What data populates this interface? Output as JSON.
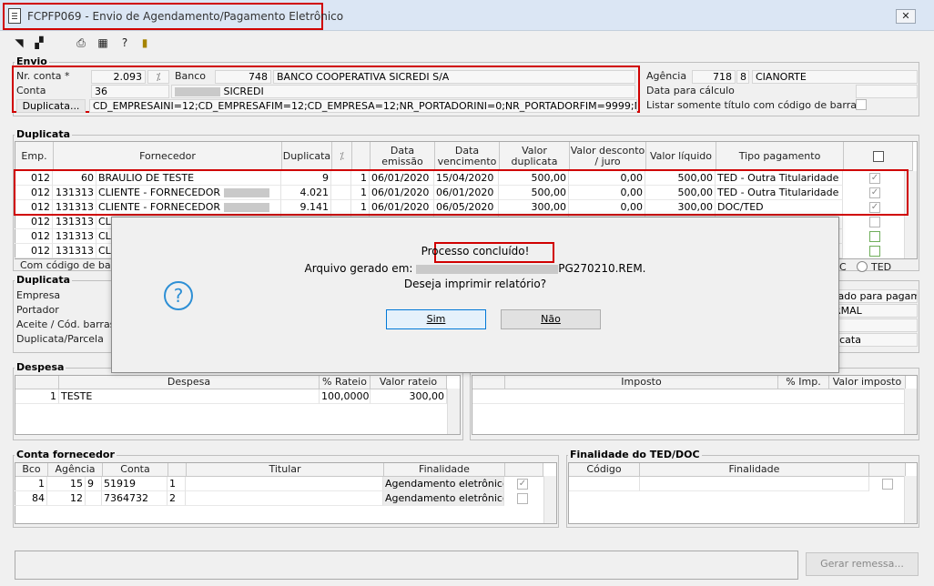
{
  "window": {
    "title": "FCPFP069 - Envio de Agendamento/Pagamento Eletrônico",
    "close_label": "✕"
  },
  "envio": {
    "group_title": "Envio",
    "nr_conta_label": "Nr. conta *",
    "nr_conta_value": "2.093",
    "banco_label": "Banco",
    "banco_code": "748",
    "banco_name": "BANCO COOPERATIVA SICREDI S/A",
    "conta_label": "Conta",
    "conta_value": "36",
    "conta_name": "SICREDI",
    "duplicata_btn": "Duplicata...",
    "duplicata_filter": "CD_EMPRESAINI=12;CD_EMPRESAFIM=12;CD_EMPRESA=12;NR_PORTADORINI=0;NR_PORTADORFIM=9999;NR_PORTAD",
    "agencia_label": "Agência",
    "agencia_value": "718",
    "agencia_digit": "8",
    "agencia_name": "CIANORTE",
    "data_calc_label": "Data para cálculo",
    "listar_label": "Listar somente título com código de barras"
  },
  "duplicata": {
    "group_title": "Duplicata",
    "headers": [
      "Emp.",
      "Fornecedor",
      "Duplicata",
      "",
      "",
      "Data emissão",
      "Data vencimento",
      "Valor duplicata",
      "Valor desconto / juro",
      "Valor líquido",
      "Tipo pagamento",
      ""
    ],
    "rows": [
      {
        "emp": "012",
        "cod": "60",
        "forn": "BRAULIO DE TESTE",
        "dup": "9",
        "parc": "1",
        "emissao": "06/01/2020",
        "venc": "15/04/2020",
        "valor": "500,00",
        "desc": "0,00",
        "liq": "500,00",
        "tipo": "TED - Outra Titularidade"
      },
      {
        "emp": "012",
        "cod": "131313",
        "forn": "CLIENTE - FORNECEDOR",
        "dup": "4.021",
        "parc": "1",
        "emissao": "06/01/2020",
        "venc": "06/01/2020",
        "valor": "500,00",
        "desc": "0,00",
        "liq": "500,00",
        "tipo": "TED - Outra Titularidade"
      },
      {
        "emp": "012",
        "cod": "131313",
        "forn": "CLIENTE - FORNECEDOR",
        "dup": "9.141",
        "parc": "1",
        "emissao": "06/01/2020",
        "venc": "06/05/2020",
        "valor": "300,00",
        "desc": "0,00",
        "liq": "300,00",
        "tipo": "DOC/TED"
      },
      {
        "emp": "012",
        "cod": "131313",
        "forn": "CL"
      },
      {
        "emp": "012",
        "cod": "131313",
        "forn": "CL"
      },
      {
        "emp": "012",
        "cod": "131313",
        "forn": "CL"
      }
    ],
    "footer_label": "Com código de bar",
    "radio_c_label": "C",
    "radio_ted_label": "TED"
  },
  "detalhe": {
    "group_title": "Duplicata",
    "empresa_label": "Empresa",
    "portador_label": "Portador",
    "aceite_label": "Aceite / Cód. barras",
    "dupparc_label": "Duplicata/Parcela",
    "right_1": "rado para pagame",
    "right_2": "RMAL",
    "right_3": "licata"
  },
  "despesa": {
    "group_title": "Despesa",
    "headers": [
      "",
      "Despesa",
      "% Rateio",
      "Valor rateio"
    ],
    "rows": [
      {
        "n": "1",
        "desc": "TESTE",
        "rateio": "100,000000",
        "valor": "300,00"
      }
    ]
  },
  "imposto": {
    "headers": [
      "",
      "Imposto",
      "% Imp.",
      "Valor imposto"
    ]
  },
  "conta_fornecedor": {
    "group_title": "Conta fornecedor",
    "headers": [
      "Bco",
      "Agência",
      "Conta",
      "",
      "Titular",
      "Finalidade",
      ""
    ],
    "rows": [
      {
        "bco": "1",
        "ag": "15",
        "agd": "9",
        "conta": "51919",
        "cd": "1",
        "titular": "",
        "final": "Agendamento eletrônico"
      },
      {
        "bco": "84",
        "ag": "12",
        "agd": "",
        "conta": "7364732",
        "cd": "2",
        "titular": "",
        "final": "Agendamento eletrônico"
      }
    ]
  },
  "finalidade_ted": {
    "group_title": "Finalidade do TED/DOC",
    "headers": [
      "Código",
      "Finalidade",
      ""
    ]
  },
  "bottom": {
    "gerar_label": "Gerar remessa..."
  },
  "dialog": {
    "message_1": "Processo concluído!",
    "message_2_prefix": "Arquivo gerado em:",
    "message_2_suffix": "PG270210.REM.",
    "message_3": "Deseja imprimir relatório?",
    "yes_label": "Sim",
    "no_label": "Não",
    "icon_glyph": "?"
  }
}
